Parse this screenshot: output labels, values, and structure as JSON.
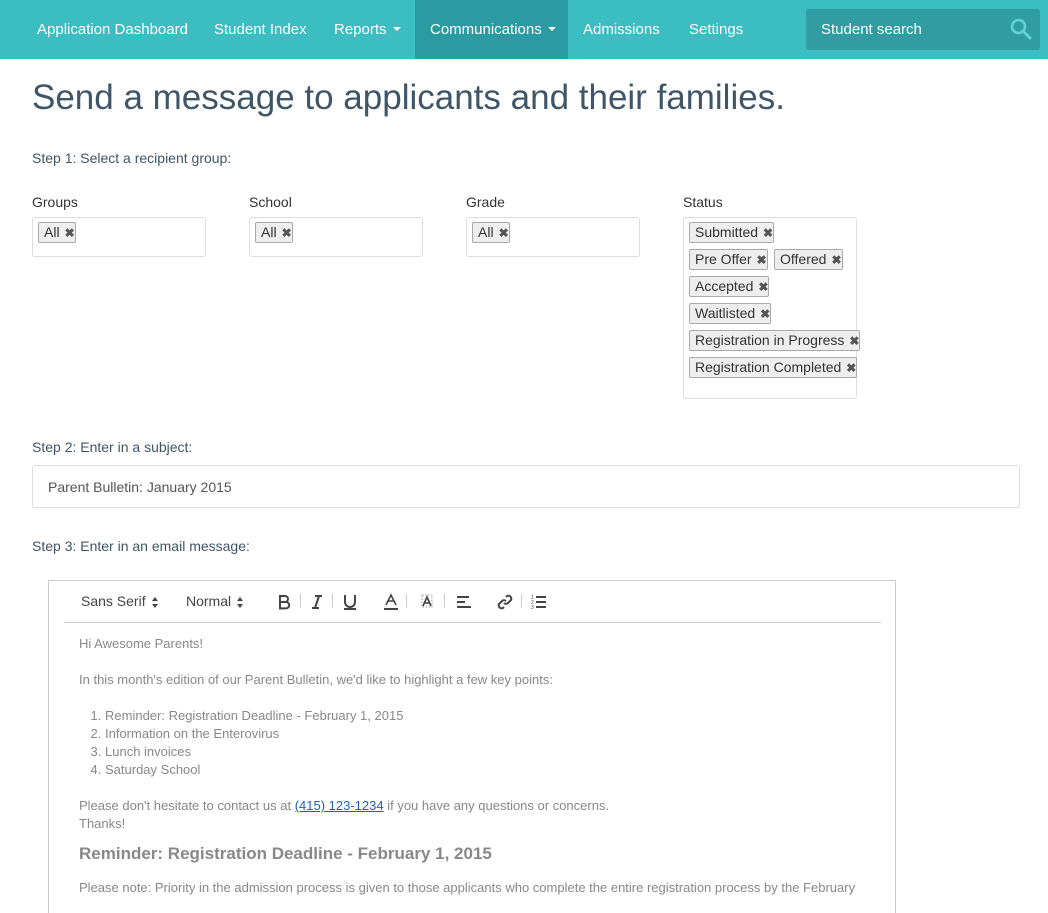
{
  "nav": {
    "items": [
      {
        "label": "Application Dashboard",
        "dropdown": false,
        "active": false
      },
      {
        "label": "Student Index",
        "dropdown": false,
        "active": false
      },
      {
        "label": "Reports",
        "dropdown": true,
        "active": false
      },
      {
        "label": "Communications",
        "dropdown": true,
        "active": true
      },
      {
        "label": "Admissions",
        "dropdown": false,
        "active": false
      },
      {
        "label": "Settings",
        "dropdown": false,
        "active": false
      }
    ],
    "search_placeholder": "Student search",
    "search_icon": "search-icon"
  },
  "page": {
    "title": "Send a message to applicants and their families.",
    "step1": "Step 1: Select a recipient group:",
    "step2": "Step 2: Enter in a subject:",
    "step3": "Step 3: Enter in an email message:"
  },
  "filters": {
    "groups": {
      "label": "Groups",
      "tags": [
        "All"
      ]
    },
    "school": {
      "label": "School",
      "tags": [
        "All"
      ]
    },
    "grade": {
      "label": "Grade",
      "tags": [
        "All"
      ]
    },
    "status": {
      "label": "Status",
      "tags": [
        "Submitted",
        "Pre Offer",
        "Offered",
        "Accepted",
        "Waitlisted",
        "Registration in Progress",
        "Registration Completed"
      ]
    }
  },
  "tag_remove_glyph": "✖",
  "subject": {
    "value": "Parent Bulletin: January 2015"
  },
  "editor": {
    "font_select": "Sans Serif",
    "size_select": "Normal",
    "toolbar_icons": [
      "bold-icon",
      "italic-icon",
      "underline-icon",
      "text-color-icon",
      "background-color-icon",
      "align-icon",
      "link-icon",
      "ordered-list-icon"
    ],
    "greeting": "Hi Awesome Parents!",
    "intro": "In this month's edition of our Parent Bulletin, we'd like to highlight a few key points:",
    "points": [
      "Reminder: Registration Deadline - February 1, 2015",
      "Information on the Enterovirus",
      "Lunch invoices",
      "Saturday School"
    ],
    "contact_before": "Please don't hesitate to contact us at ",
    "contact_phone": "(415) 123-1234",
    "contact_after": " if you have any questions or concerns.",
    "thanks": "Thanks!",
    "section_heading": "Reminder: Registration Deadline - February 1, 2015",
    "section_text": "Please note: Priority in the admission process is given to those applicants who complete the entire registration process by the February"
  }
}
